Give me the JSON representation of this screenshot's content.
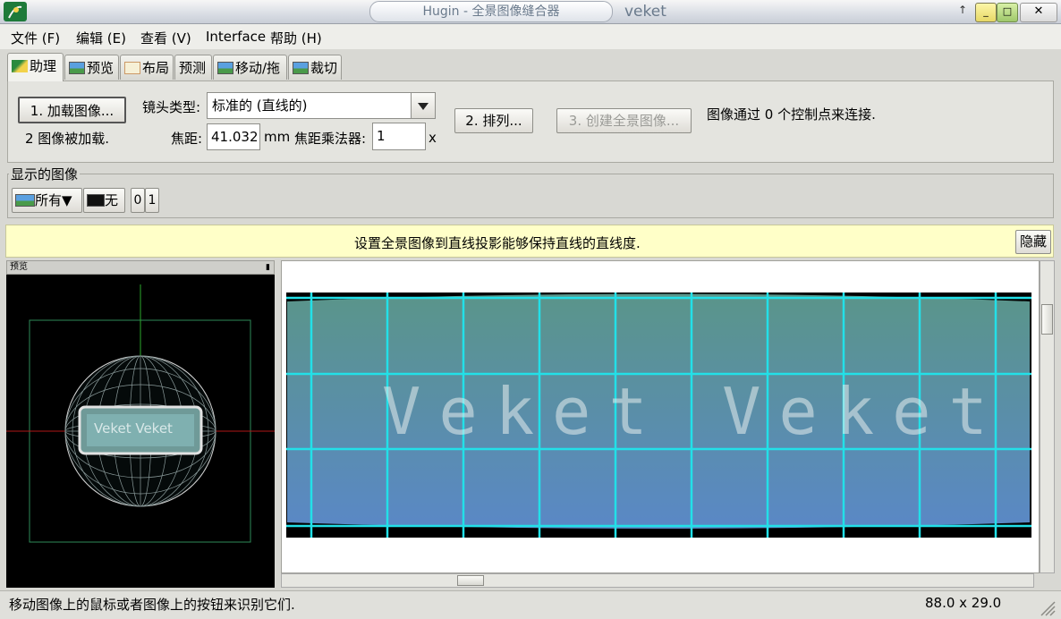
{
  "window": {
    "title": "Hugin - 全景图像缝合器",
    "title_right": "veket",
    "buttons": [
      "_",
      "□",
      "✕"
    ]
  },
  "menu": [
    "文件 (F)",
    "编辑 (E)",
    "查看 (V)",
    "Interface",
    "帮助 (H)"
  ],
  "tabs": [
    "助理",
    "预览",
    "布局",
    "预测",
    "移动/拖",
    "裁切"
  ],
  "assistant": {
    "load_button": "1. 加载图像...",
    "loaded_text": "2 图像被加载.",
    "lens_type_label": "镜头类型:",
    "lens_type_value": "标准的 (直线的)",
    "focal_label": "焦距:",
    "focal_value": "41.032",
    "focal_unit": "mm",
    "multiplier_label": "焦距乘法器:",
    "multiplier_value": "1",
    "multiplier_unit": "x",
    "align_button": "2. 排列...",
    "create_button": "3. 创建全景图像...",
    "status": "图像通过 0 个控制点来连接."
  },
  "displayed_images": {
    "title": "显示的图像",
    "all_button": "所有",
    "none_button": "无",
    "image_toggles": [
      "0",
      "1"
    ]
  },
  "hint": {
    "text": "设置全景图像到直线投影能够保持直线的直线度.",
    "hide_button": "隐藏"
  },
  "preview_panel": {
    "title": "预览",
    "pin": "📌",
    "sphere_text": "Veket Veket"
  },
  "panorama": {
    "text": "Veket Veket"
  },
  "statusbar": {
    "message": "移动图像上的鼠标或者图像上的按钮来识别它们.",
    "fov": "88.0 x 29.0"
  },
  "colors": {
    "grid": "#22e0e8",
    "sky_top": "#5a958a",
    "sky_bottom": "#5a88c6"
  }
}
